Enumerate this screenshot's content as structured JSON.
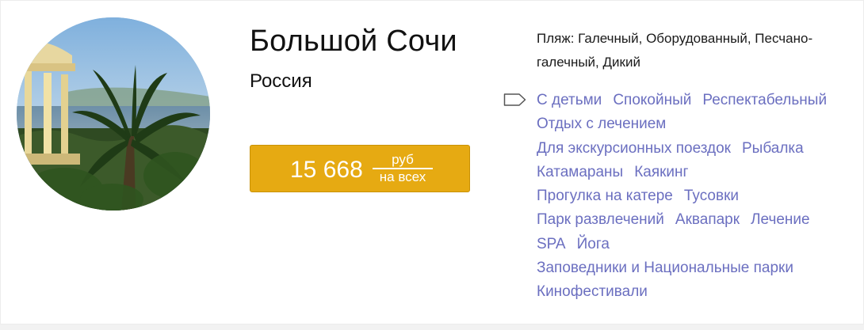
{
  "destination": {
    "name": "Большой Сочи",
    "country": "Россия"
  },
  "price": {
    "amount": "15 668",
    "currency": "руб",
    "basis": "на всех"
  },
  "beach": {
    "text": "Пляж: Галечный, Оборудованный, Песчано-галечный, Дикий"
  },
  "tag_icon": "tag-icon",
  "tags": [
    [
      "С детьми",
      "Спокойный",
      "Респектабельный"
    ],
    [
      "Отдых с лечением"
    ],
    [
      "Для экскурсионных поездок",
      "Рыбалка"
    ],
    [
      "Катамараны",
      "Каякинг"
    ],
    [
      "Прогулка на катере",
      "Тусовки"
    ],
    [
      "Парк развлечений",
      "Аквапарк",
      "Лечение"
    ],
    [
      "SPA",
      "Йога"
    ],
    [
      "Заповедники и Национальные парки"
    ],
    [
      "Кинофестивали"
    ]
  ],
  "colors": {
    "link": "#6b6fc0",
    "button": "#e6aa12",
    "text": "#111111"
  }
}
